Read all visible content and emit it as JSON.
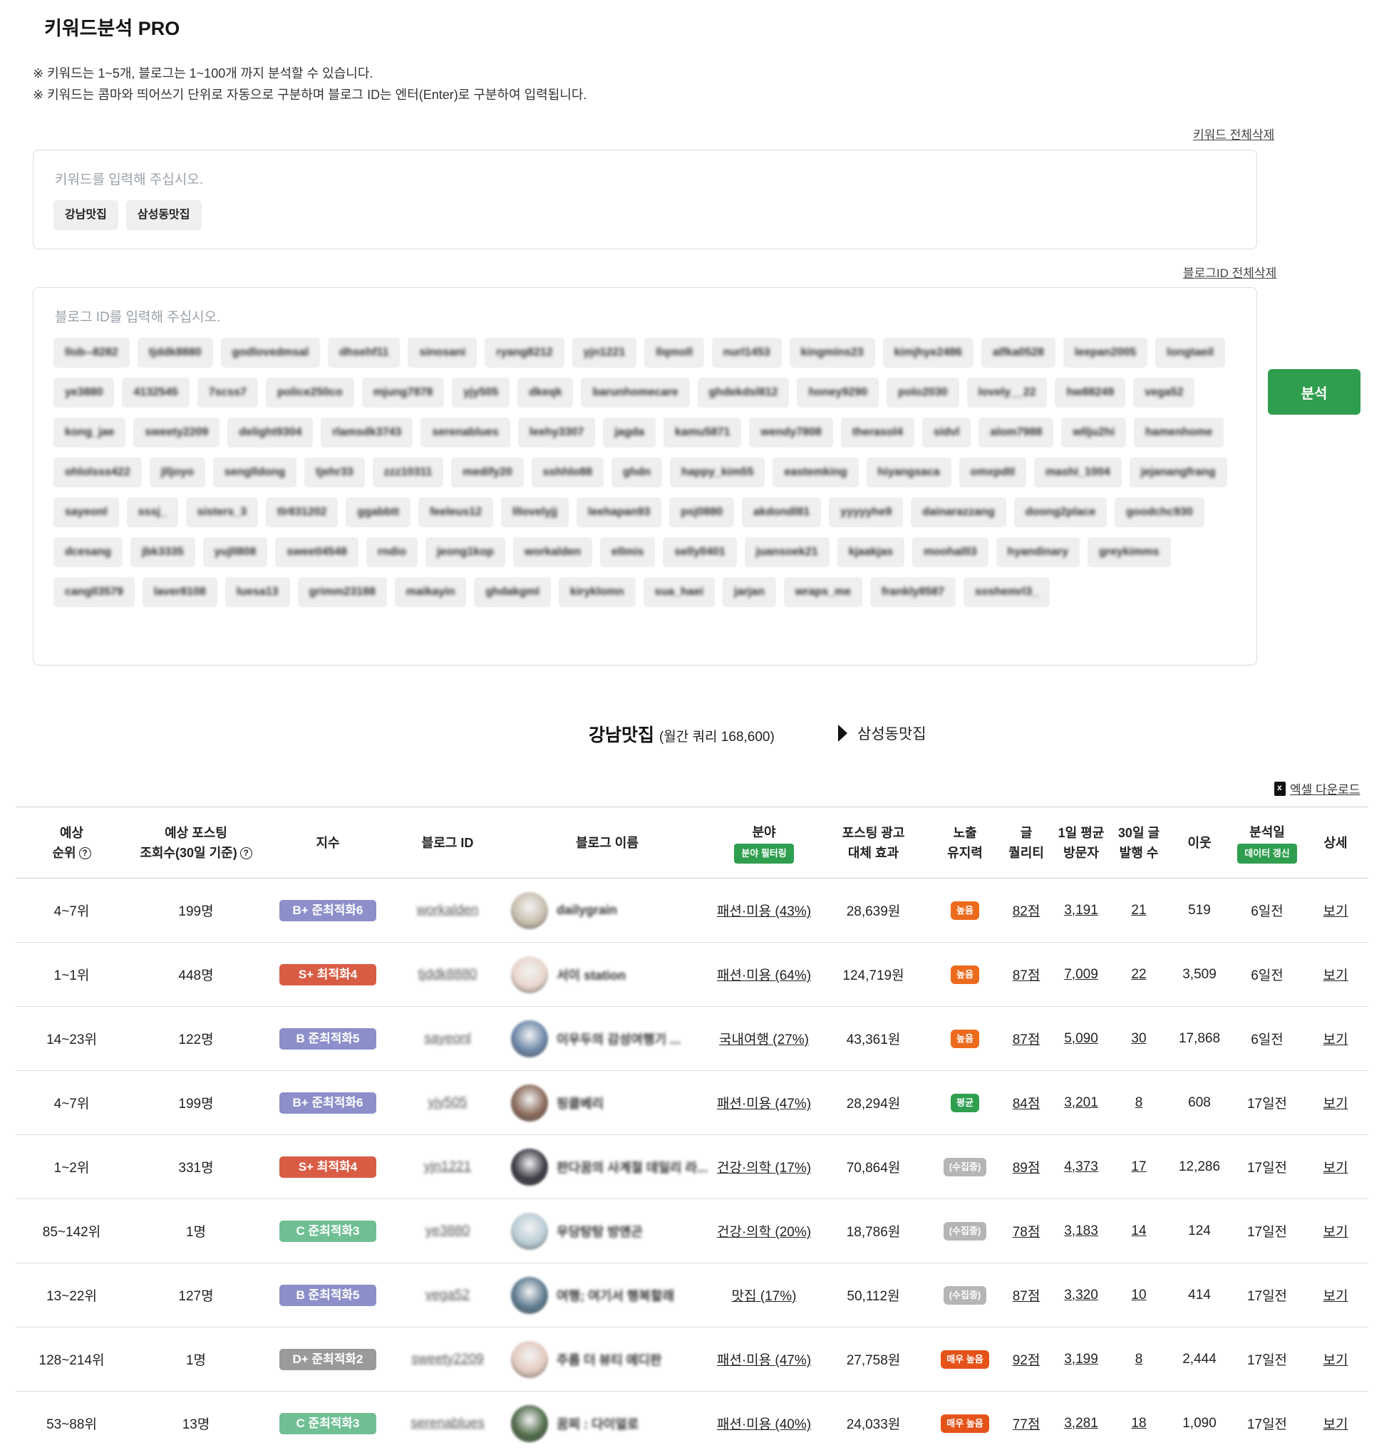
{
  "page": {
    "title": "키워드분석 PRO",
    "notes": [
      "※ 키워드는 1~5개, 블로그는 1~100개 까지 분석할 수 있습니다.",
      "※ 키워드는 콤마와 띄어쓰기 단위로 자동으로 구분하며 블로그 ID는 엔터(Enter)로 구분하여 입력됩니다."
    ]
  },
  "keywords": {
    "delete_all_label": "키워드 전체삭제",
    "placeholder": "키워드를 입력해 주십시오.",
    "chips": [
      "강남맛집",
      "삼성동맛집"
    ]
  },
  "blogs": {
    "delete_all_label": "블로그ID 전체삭제",
    "placeholder": "블로그 ID를 입력해 주십시오.",
    "chips": [
      "llob--8282",
      "tjddk8880",
      "godlovedmsal",
      "dhsehf11",
      "sinosani",
      "ryang8212",
      "yjn1221",
      "llqmoll",
      "nurl1453",
      "kingmins23",
      "kimjhye2486",
      "alfka0528",
      "leepan2005",
      "longtaeil",
      "ye3880",
      "4132545",
      "7scss7",
      "police250co",
      "mjung7878",
      "yjy505",
      "dkeqk",
      "barunhomecare",
      "ghdekdsl812",
      "honey9290",
      "polo2030",
      "lovely__22",
      "hw88249",
      "vega52",
      "kong_jae",
      "sweety2209",
      "delight9304",
      "rlamsdk3743",
      "serenablues",
      "leehy3307",
      "jagda",
      "kamu5871",
      "wendy7808",
      "therasol4",
      "sidvl",
      "alom7988",
      "wllju2hi",
      "hamenhome",
      "ohlolsss422",
      "jlljoyo",
      "senglldong",
      "tjehr33",
      "zzz10311",
      "medify20",
      "sshhlo88",
      "ghdn",
      "happy_kim55",
      "eastemking",
      "hiyangsaca",
      "omxpdtl",
      "mashi_1004",
      "jejanangfrang",
      "sayeonl",
      "sssj_",
      "sisters_3",
      "tlr831202",
      "ggabbtt",
      "feeleus12",
      "lllovelyjj",
      "leehapan93",
      "psj0880",
      "akdondl81",
      "yyyyyhe9",
      "dainarazzang",
      "doong2place",
      "goodchc930",
      "dcesang",
      "jbk3335",
      "yujll808",
      "sweetl4548",
      "rndio",
      "jeong1kop",
      "workalden",
      "ellmis",
      "sellyll401",
      "juansoek21",
      "kjaakjas",
      "moohalll3",
      "hyandinary",
      "greykimms",
      "cangll3579",
      "laver8108",
      "luesa13",
      "grimm23188",
      "maikayin",
      "ghdakgml",
      "kiryklomn",
      "sua_haei",
      "jarjan",
      "wraps_me",
      "frankly8587",
      "soshemrl3_"
    ]
  },
  "analyze_label": "분석",
  "keyword_tabs": {
    "active": "강남맛집",
    "active_query": "(월간 쿼리 168,600)",
    "next": "삼성동맛집"
  },
  "excel_label": "엑셀 다운로드",
  "table": {
    "headers": {
      "rank": [
        "예상",
        "순위"
      ],
      "views": [
        "예상 포스팅",
        "조회수(30일 기준)"
      ],
      "index": "지수",
      "blog_id": "블로그 ID",
      "blog_name": "블로그 이름",
      "field": "분야",
      "field_filter": "분야 필터링",
      "ad_value": [
        "포스팅 광고",
        "대체 효과"
      ],
      "retention": [
        "노출",
        "유지력"
      ],
      "quality": [
        "글",
        "퀄리티"
      ],
      "visitors": [
        "1일 평균",
        "방문자"
      ],
      "posts": [
        "30일 글",
        "발행 수"
      ],
      "neighbors": "이웃",
      "analyzed": "분석일",
      "refresh": "데이터 갱신",
      "detail": "상세"
    },
    "rows": [
      {
        "rank": "4~7위",
        "views": "199명",
        "index": "B+ 준최적화6",
        "index_color": "#8c8fc9",
        "blog_id": "workalden",
        "avatar_color": "#c9bfae",
        "blog_name": "dailygrain",
        "field": "패션·미용 (43%)",
        "ad": "28,639원",
        "retention": "높음",
        "ret_color": "#ec6a1c",
        "quality": "82점",
        "visitors": "3,191",
        "posts": "21",
        "neighbors": "519",
        "analyzed": "6일전",
        "detail": "보기"
      },
      {
        "rank": "1~1위",
        "views": "448명",
        "index": "S+ 최적화4",
        "index_color": "#d95d45",
        "blog_id": "tjddk8880",
        "avatar_color": "#e8d6cc",
        "blog_name": "서이 station",
        "field": "패션·미용 (64%)",
        "ad": "124,719원",
        "retention": "높음",
        "ret_color": "#ec6a1c",
        "quality": "87점",
        "visitors": "7,009",
        "posts": "22",
        "neighbors": "3,509",
        "analyzed": "6일전",
        "detail": "보기"
      },
      {
        "rank": "14~23위",
        "views": "122명",
        "index": "B 준최적화5",
        "index_color": "#8c8fc9",
        "blog_id": "sayeonl",
        "avatar_color": "#6b86a8",
        "blog_name": "이우두의 감성여행기 ...",
        "field": "국내여행 (27%)",
        "ad": "43,361원",
        "retention": "높음",
        "ret_color": "#ec6a1c",
        "quality": "87점",
        "visitors": "5,090",
        "posts": "30",
        "neighbors": "17,868",
        "analyzed": "6일전",
        "detail": "보기"
      },
      {
        "rank": "4~7위",
        "views": "199명",
        "index": "B+ 준최적화6",
        "index_color": "#8c8fc9",
        "blog_id": "yjy505",
        "avatar_color": "#8a6a5a",
        "blog_name": "핑클베리",
        "field": "패션·미용 (47%)",
        "ad": "28,294원",
        "retention": "평균",
        "ret_color": "#2f9e4e",
        "quality": "84점",
        "visitors": "3,201",
        "posts": "8",
        "neighbors": "608",
        "analyzed": "17일전",
        "detail": "보기"
      },
      {
        "rank": "1~2위",
        "views": "331명",
        "index": "S+ 최적화4",
        "index_color": "#d95d45",
        "blog_id": "yjn1221",
        "avatar_color": "#3b3b45",
        "blog_name": "판다꿈의 사계절 데일리 라...",
        "field": "건강·의학 (17%)",
        "ad": "70,864원",
        "retention": "(수집중)",
        "ret_color": "#b5b5b5",
        "quality": "89점",
        "visitors": "4,373",
        "posts": "17",
        "neighbors": "12,286",
        "analyzed": "17일전",
        "detail": "보기"
      },
      {
        "rank": "85~142위",
        "views": "1명",
        "index": "C 준최적화3",
        "index_color": "#6fbf93",
        "blog_id": "ye3880",
        "avatar_color": "#b9ccd6",
        "blog_name": "우당탕탕 방앤곤",
        "field": "건강·의학 (20%)",
        "ad": "18,786원",
        "retention": "(수집중)",
        "ret_color": "#b5b5b5",
        "quality": "78점",
        "visitors": "3,183",
        "posts": "14",
        "neighbors": "124",
        "analyzed": "17일전",
        "detail": "보기"
      },
      {
        "rank": "13~22위",
        "views": "127명",
        "index": "B 준최적화5",
        "index_color": "#8c8fc9",
        "blog_id": "vega52",
        "avatar_color": "#5d7b8f",
        "blog_name": "여행; 여기서 행복할래",
        "field": "맛집 (17%)",
        "ad": "50,112원",
        "retention": "(수집중)",
        "ret_color": "#b5b5b5",
        "quality": "87점",
        "visitors": "3,320",
        "posts": "10",
        "neighbors": "414",
        "analyzed": "17일전",
        "detail": "보기"
      },
      {
        "rank": "128~214위",
        "views": "1명",
        "index": "D+ 준최적화2",
        "index_color": "#9a9a9a",
        "blog_id": "sweety2209",
        "avatar_color": "#e3c9bf",
        "blog_name": "주름 더 뷰티 에디판",
        "field": "패션·미용 (47%)",
        "ad": "27,758원",
        "retention": "매우 높음",
        "ret_color": "#e5531a",
        "quality": "92점",
        "visitors": "3,199",
        "posts": "8",
        "neighbors": "2,444",
        "analyzed": "17일전",
        "detail": "보기"
      },
      {
        "rank": "53~88위",
        "views": "13명",
        "index": "C 준최적화3",
        "index_color": "#6fbf93",
        "blog_id": "serenablues",
        "avatar_color": "#4f6b4a",
        "blog_name": "꿈찌 : 다이얼로",
        "field": "패션·미용 (40%)",
        "ad": "24,033원",
        "retention": "매우 높음",
        "ret_color": "#e5531a",
        "quality": "77점",
        "visitors": "3,281",
        "posts": "18",
        "neighbors": "1,090",
        "analyzed": "17일전",
        "detail": "보기"
      }
    ]
  }
}
